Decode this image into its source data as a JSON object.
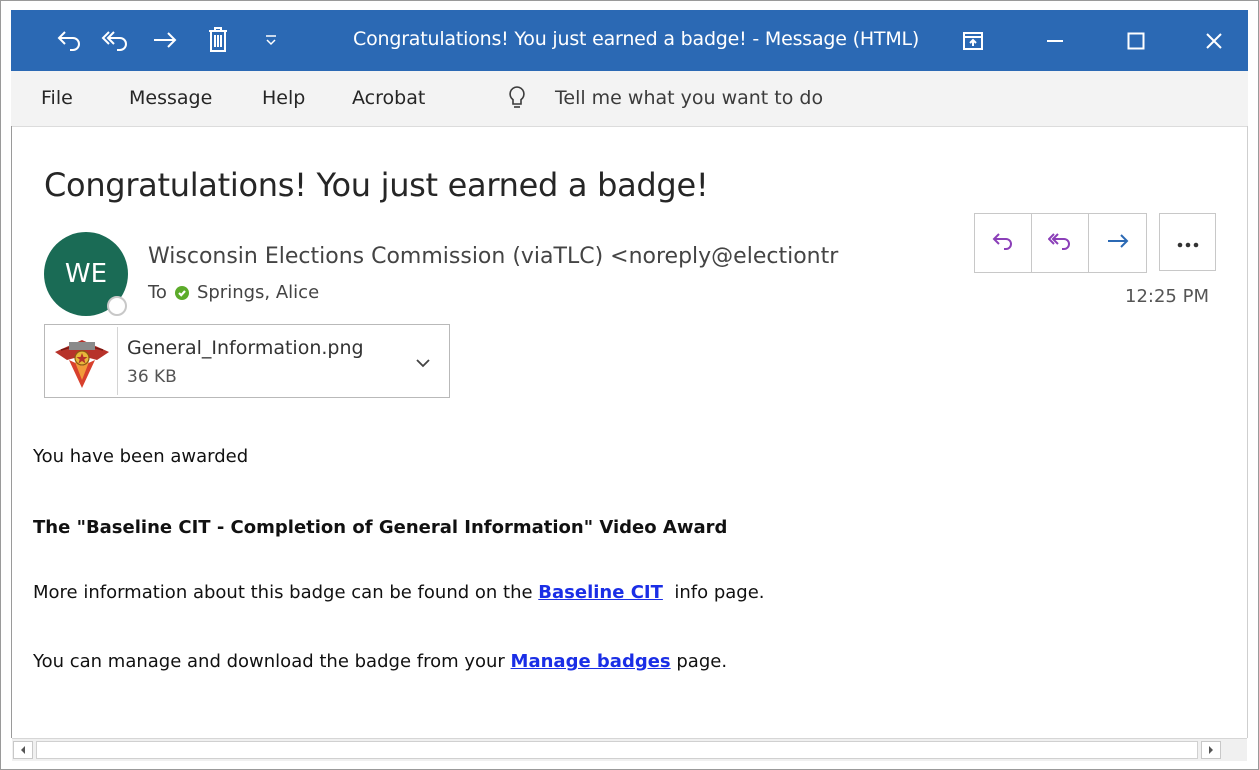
{
  "window": {
    "title": "Congratulations! You just earned a badge!  -  Message (HTML)",
    "toolbar_icons": [
      "undo-icon",
      "undo-all-icon",
      "forward-icon",
      "delete-icon",
      "customize-dropdown-icon"
    ],
    "controls": [
      "ribbon-display-icon",
      "minimize-icon",
      "maximize-icon",
      "close-icon"
    ]
  },
  "menu": {
    "items": [
      "File",
      "Message",
      "Help",
      "Acrobat"
    ],
    "tellme_placeholder": "Tell me what you want to do"
  },
  "message": {
    "subject": "Congratulations! You just earned a badge!",
    "avatar_initials": "WE",
    "avatar_color": "#1a6b55",
    "sender": "Wisconsin Elections Commission  (viaTLC) <noreply@electiontr",
    "to_label": "To",
    "recipient": "Springs, Alice",
    "time": "12:25 PM",
    "actions": [
      "reply-icon",
      "reply-all-icon",
      "forward-icon",
      "more-icon"
    ],
    "accent_color": "#8b3fb8"
  },
  "attachment": {
    "name": "General_Information.png",
    "size": "36 KB"
  },
  "body": {
    "line1": "You have been awarded",
    "line2": "The \"Baseline CIT - Completion of General Information\" Video Award",
    "line3_pre": "More information about this badge can be found on the ",
    "line3_link": "Baseline CIT",
    "line3_post": "  info page.",
    "line4_pre": "You can manage and download the badge from your ",
    "line4_link": "Manage badges",
    "line4_post": " page.",
    "link_color": "#1a2ee6"
  }
}
